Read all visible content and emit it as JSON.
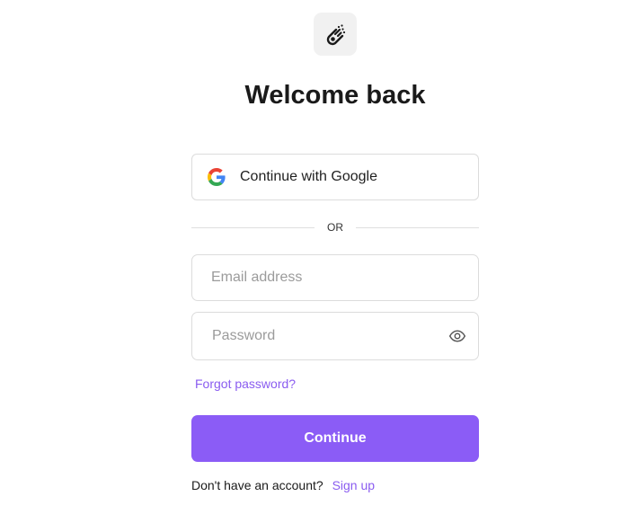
{
  "logo": {
    "icon": "comet-icon"
  },
  "header": {
    "title": "Welcome back"
  },
  "google_button": {
    "label": "Continue with Google",
    "icon": "google-icon"
  },
  "divider": {
    "label": "OR"
  },
  "email": {
    "placeholder": "Email address",
    "value": ""
  },
  "password": {
    "placeholder": "Password",
    "value": "",
    "toggle_icon": "eye-icon"
  },
  "forgot_password": {
    "label": "Forgot password?"
  },
  "continue_button": {
    "label": "Continue"
  },
  "signup": {
    "prompt": "Don't have an account?",
    "link_label": "Sign up"
  },
  "colors": {
    "accent": "#8b5cf6",
    "link": "#8a5cf0",
    "border": "#dcdcdc",
    "logo_bg": "#f1f1f1"
  }
}
